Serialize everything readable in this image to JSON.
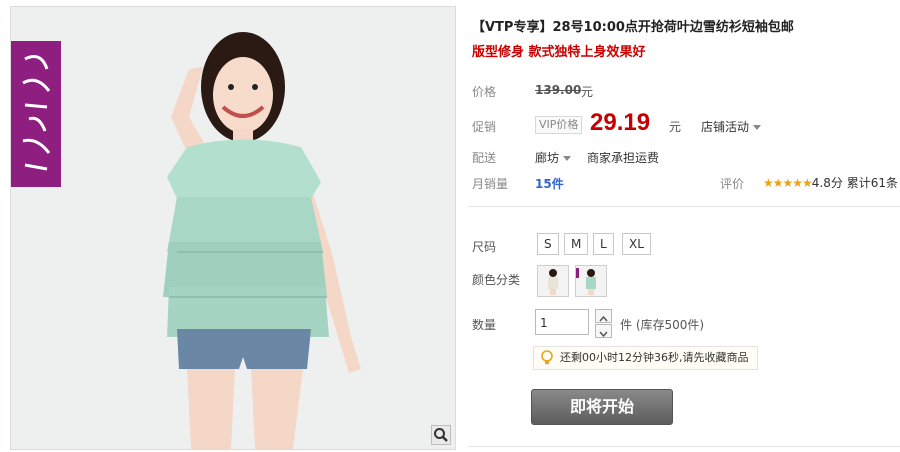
{
  "product": {
    "title": "【VTP专享】28号10:00点开抢荷叶边雪纺衫短袖包邮",
    "subtitle": "版型修身 款式独特上身效果好"
  },
  "price": {
    "label": "价格",
    "original": "139.00",
    "currency": "元"
  },
  "promotion": {
    "label": "促销",
    "tag": "VIP价格",
    "price": "29.19",
    "currency": "元",
    "activity": "店铺活动"
  },
  "shipping": {
    "label": "配送",
    "location": "廊坊",
    "fee_note": "商家承担运费"
  },
  "sales": {
    "label": "月销量",
    "count": "15件",
    "rating_label": "评价",
    "stars": "★★★★★",
    "score": "4.8分",
    "total_reviews": "累计61条"
  },
  "size": {
    "label": "尺码",
    "options": [
      "S",
      "M",
      "L",
      "XL"
    ]
  },
  "color": {
    "label": "颜色分类"
  },
  "quantity": {
    "label": "数量",
    "value": "1",
    "stock": "件 (库存500件)"
  },
  "countdown": {
    "text": "还剩00小时12分钟36秒,请先收藏商品"
  },
  "buy_button": {
    "label": "即将开始"
  },
  "brand": {
    "logo_text": "花香贝拉"
  },
  "colors": {
    "price_red": "#c40000",
    "title_red": "#cc0000",
    "brand_purple": "#8e1e7f",
    "blouse_mint": "#a9d7c6",
    "star_gold": "#e8a317"
  }
}
